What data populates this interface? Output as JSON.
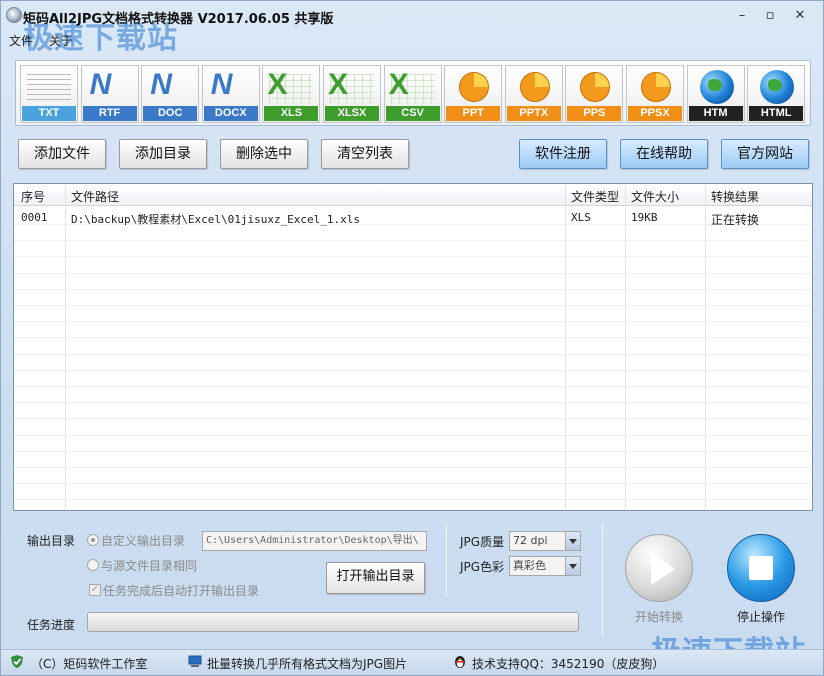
{
  "window": {
    "title": "矩码All2JPG文档格式转换器 V2017.06.05 共享版"
  },
  "watermark": "极速下载站",
  "menu": [
    "文件",
    "关于"
  ],
  "formats": [
    {
      "label": "TXT",
      "kind": "text",
      "color": "#4aa3df"
    },
    {
      "label": "RTF",
      "kind": "word",
      "color": "#3a78c8"
    },
    {
      "label": "DOC",
      "kind": "word",
      "color": "#3a78c8"
    },
    {
      "label": "DOCX",
      "kind": "word",
      "color": "#3a78c8"
    },
    {
      "label": "XLS",
      "kind": "excel",
      "color": "#3f9d2e"
    },
    {
      "label": "XLSX",
      "kind": "excel",
      "color": "#3f9d2e"
    },
    {
      "label": "CSV",
      "kind": "excel",
      "color": "#3f9d2e"
    },
    {
      "label": "PPT",
      "kind": "ppt",
      "color": "#f18e16"
    },
    {
      "label": "PPTX",
      "kind": "ppt",
      "color": "#f18e16"
    },
    {
      "label": "PPS",
      "kind": "ppt",
      "color": "#f18e16"
    },
    {
      "label": "PPSX",
      "kind": "ppt",
      "color": "#f18e16"
    },
    {
      "label": "HTM",
      "kind": "web",
      "color": "#222222"
    },
    {
      "label": "HTML",
      "kind": "web",
      "color": "#222222"
    }
  ],
  "toolbar": {
    "add_file": "添加文件",
    "add_folder": "添加目录",
    "delete_selected": "删除选中",
    "clear_list": "清空列表",
    "register": "软件注册",
    "online_help": "在线帮助",
    "official_site": "官方网站"
  },
  "table": {
    "headers": [
      "序号",
      "文件路径",
      "文件类型",
      "文件大小",
      "转换结果"
    ],
    "rows": [
      [
        "0001",
        "D:\\backup\\教程素材\\Excel\\01jisuxz_Excel_1.xls",
        "XLS",
        "19KB",
        "正在转换"
      ]
    ]
  },
  "output": {
    "label": "输出目录",
    "option_custom": "自定义输出目录",
    "option_same": "与源文件目录相同",
    "auto_open": "任务完成后自动打开输出目录",
    "path": "C:\\Users\\Administrator\\Desktop\\导出\\",
    "open_button": "打开输出目录"
  },
  "jpg": {
    "quality_label": "JPG质量",
    "quality_value": "72 dpi",
    "color_label": "JPG色彩",
    "color_value": "真彩色"
  },
  "actions": {
    "start": "开始转换",
    "stop": "停止操作"
  },
  "progress": {
    "label": "任务进度",
    "fraction": 0.0
  },
  "status": {
    "copyright": "（C）矩码软件工作室",
    "slogan": "批量转换几乎所有格式文档为JPG图片",
    "support": "技术支持QQ：3452190（皮皮狗）"
  }
}
